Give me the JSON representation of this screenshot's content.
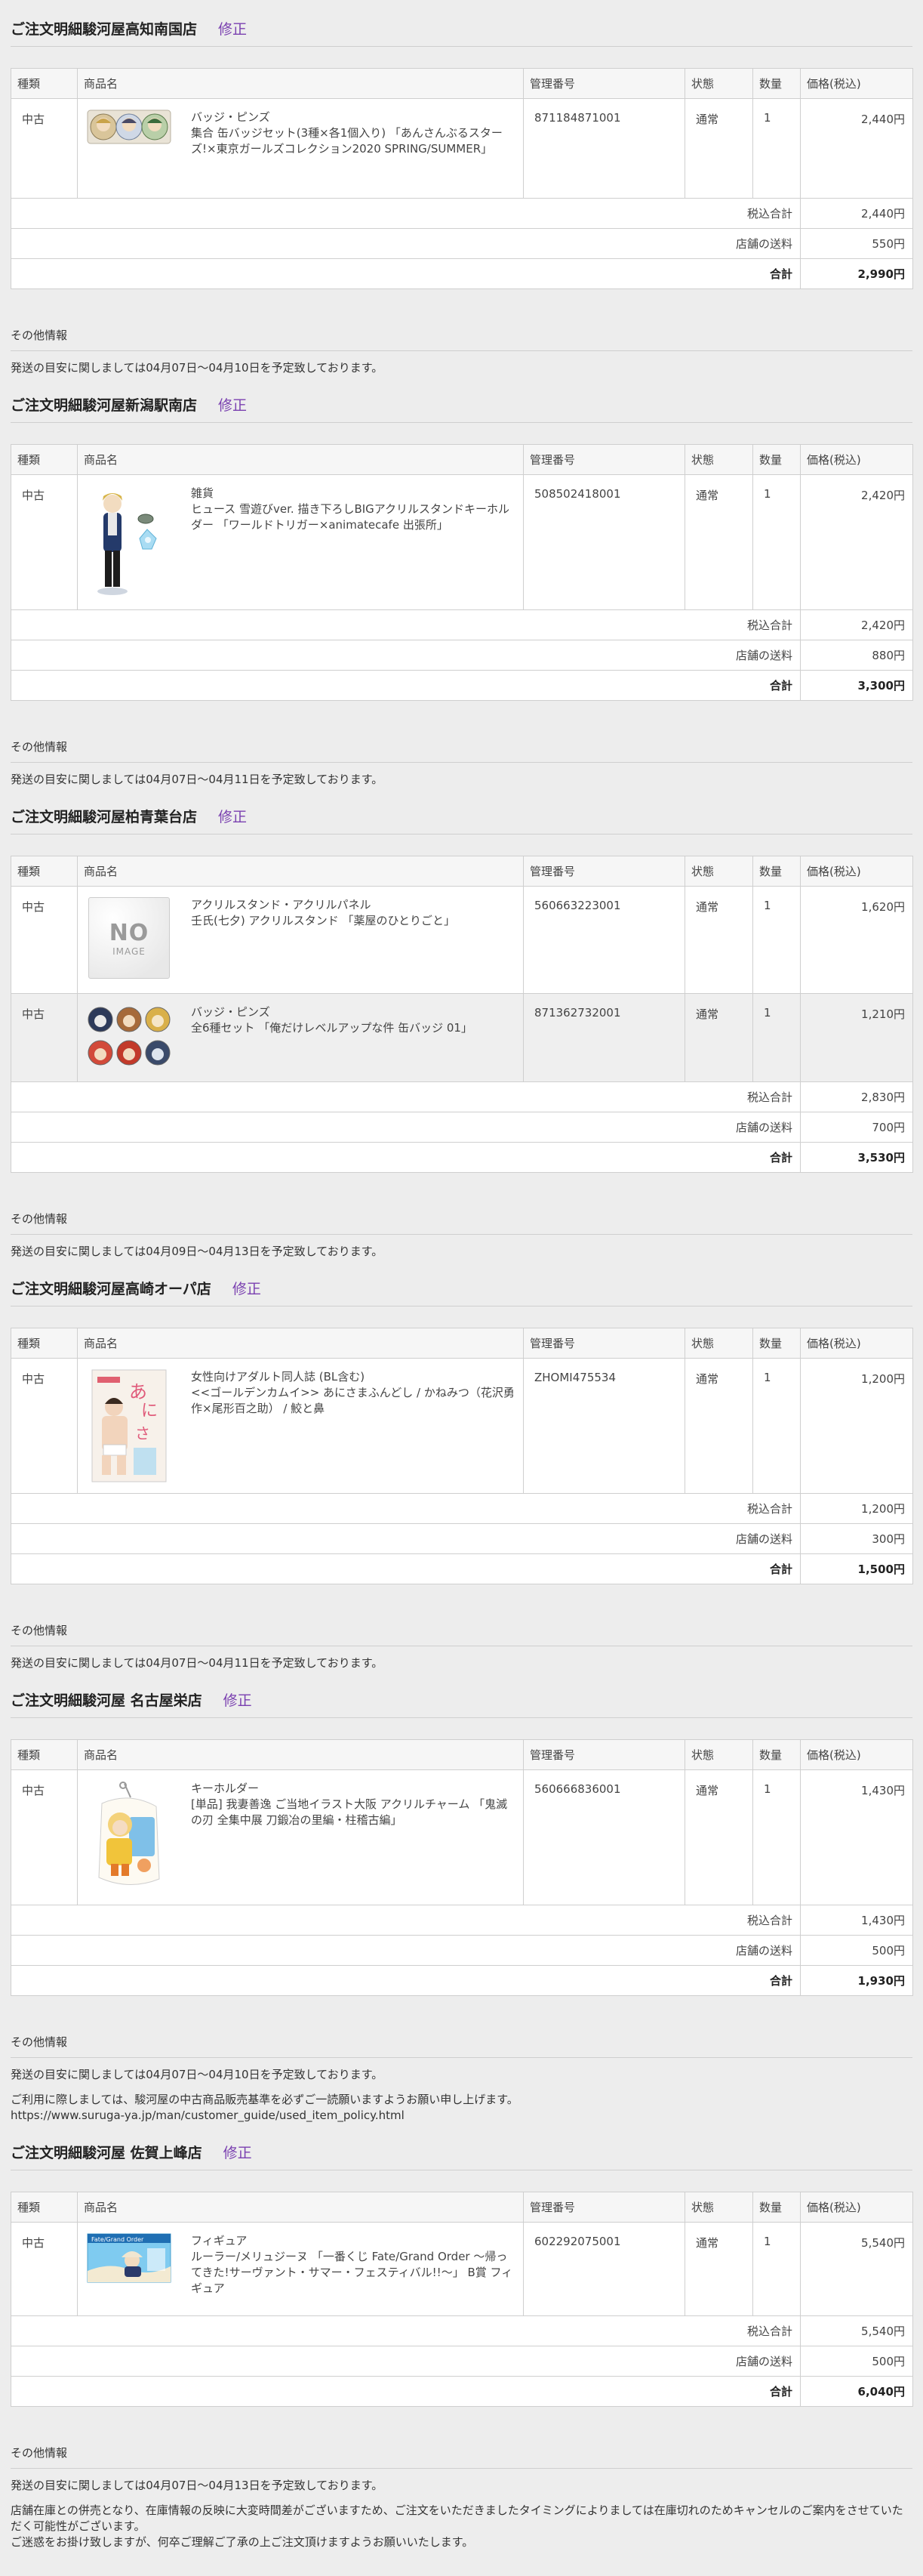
{
  "shops": [
    {
      "title": "ご注文明細駿河屋高知南国店",
      "edit": "修正",
      "headers": [
        "種類",
        "商品名",
        "管理番号",
        "状態",
        "数量",
        "価格(税込)"
      ],
      "items": [
        {
          "type": "中古",
          "category": "バッジ・ピンズ",
          "name": "集合 缶バッジセット(3種×各1個入り) 「あんさんぶるスターズ!×東京ガールズコレクション2020 SPRING/SUMMER」",
          "code": "871184871001",
          "status": "通常",
          "qty": "1",
          "price": "2,440円",
          "thumb": "badges3"
        }
      ],
      "summary": [
        {
          "label": "税込合計",
          "value": "2,440円"
        },
        {
          "label": "店舗の送料",
          "value": "550円"
        },
        {
          "label": "合計",
          "value": "2,990円"
        }
      ],
      "info_label": "その他情報",
      "info": [
        "発送の目安に関しましては04月07日～04月10日を予定致しております。"
      ]
    },
    {
      "title": "ご注文明細駿河屋新潟駅南店",
      "edit": "修正",
      "headers": [
        "種類",
        "商品名",
        "管理番号",
        "状態",
        "数量",
        "価格(税込)"
      ],
      "items": [
        {
          "type": "中古",
          "category": "雑貨",
          "name": "ヒュース 雪遊びver. 描き下ろしBIGアクリルスタンドキーホルダー 「ワールドトリガー×animatecafe 出張所」",
          "code": "508502418001",
          "status": "通常",
          "qty": "1",
          "price": "2,420円",
          "thumb": "figure"
        }
      ],
      "summary": [
        {
          "label": "税込合計",
          "value": "2,420円"
        },
        {
          "label": "店舗の送料",
          "value": "880円"
        },
        {
          "label": "合計",
          "value": "3,300円"
        }
      ],
      "info_label": "その他情報",
      "info": [
        "発送の目安に関しましては04月07日～04月11日を予定致しております。"
      ]
    },
    {
      "title": "ご注文明細駿河屋柏青葉台店",
      "edit": "修正",
      "headers": [
        "種類",
        "商品名",
        "管理番号",
        "状態",
        "数量",
        "価格(税込)"
      ],
      "items": [
        {
          "type": "中古",
          "category": "アクリルスタンド・アクリルパネル",
          "name": "壬氏(七夕) アクリルスタンド 「薬屋のひとりごと」",
          "code": "560663223001",
          "status": "通常",
          "qty": "1",
          "price": "1,620円",
          "thumb": "noimage",
          "noimg_big": "NO",
          "noimg_small": "IMAGE"
        },
        {
          "type": "中古",
          "category": "バッジ・ピンズ",
          "name": "全6種セット 「俺だけレベルアップな件 缶バッジ 01」",
          "code": "871362732001",
          "status": "通常",
          "qty": "1",
          "price": "1,210円",
          "thumb": "badges6"
        }
      ],
      "summary": [
        {
          "label": "税込合計",
          "value": "2,830円"
        },
        {
          "label": "店舗の送料",
          "value": "700円"
        },
        {
          "label": "合計",
          "value": "3,530円"
        }
      ],
      "info_label": "その他情報",
      "info": [
        "発送の目安に関しましては04月09日～04月13日を予定致しております。"
      ]
    },
    {
      "title": "ご注文明細駿河屋高崎オーパ店",
      "edit": "修正",
      "headers": [
        "種類",
        "商品名",
        "管理番号",
        "状態",
        "数量",
        "価格(税込)"
      ],
      "items": [
        {
          "type": "中古",
          "category": "女性向けアダルト同人誌 (BL含む)",
          "name": "<<ゴールデンカムイ>> あにさまふんどし / かねみつ（花沢勇作×尾形百之助） / 鮫と鼻",
          "code": "ZHOMI475534",
          "status": "通常",
          "qty": "1",
          "price": "1,200円",
          "thumb": "book"
        }
      ],
      "summary": [
        {
          "label": "税込合計",
          "value": "1,200円"
        },
        {
          "label": "店舗の送料",
          "value": "300円"
        },
        {
          "label": "合計",
          "value": "1,500円"
        }
      ],
      "info_label": "その他情報",
      "info": [
        "発送の目安に関しましては04月07日～04月11日を予定致しております。"
      ]
    },
    {
      "title": "ご注文明細駿河屋 名古屋栄店",
      "edit": "修正",
      "headers": [
        "種類",
        "商品名",
        "管理番号",
        "状態",
        "数量",
        "価格(税込)"
      ],
      "items": [
        {
          "type": "中古",
          "category": "キーホルダー",
          "name": "[単品] 我妻善逸 ご当地イラスト大阪 アクリルチャーム 「鬼滅の刃 全集中展 刀鍛冶の里編・柱稽古編」",
          "code": "560666836001",
          "status": "通常",
          "qty": "1",
          "price": "1,430円",
          "thumb": "charm"
        }
      ],
      "summary": [
        {
          "label": "税込合計",
          "value": "1,430円"
        },
        {
          "label": "店舗の送料",
          "value": "500円"
        },
        {
          "label": "合計",
          "value": "1,930円"
        }
      ],
      "info_label": "その他情報",
      "info": [
        "発送の目安に関しましては04月07日～04月10日を予定致しております。",
        "",
        "ご利用に際しましては、駿河屋の中古商品販売基準を必ずご一読願いますようお願い申し上げます。",
        "https://www.suruga-ya.jp/man/customer_guide/used_item_policy.html"
      ]
    },
    {
      "title": "ご注文明細駿河屋 佐賀上峰店",
      "edit": "修正",
      "headers": [
        "種類",
        "商品名",
        "管理番号",
        "状態",
        "数量",
        "価格(税込)"
      ],
      "items": [
        {
          "type": "中古",
          "category": "フィギュア",
          "name": "ルーラー/メリュジーヌ 「一番くじ Fate/Grand Order ～帰ってきた!サーヴァント・サマー・フェスティバル!!～」 B賞 フィギュア",
          "code": "602292075001",
          "status": "通常",
          "qty": "1",
          "price": "5,540円",
          "thumb": "box"
        }
      ],
      "summary": [
        {
          "label": "税込合計",
          "value": "5,540円"
        },
        {
          "label": "店舗の送料",
          "value": "500円"
        },
        {
          "label": "合計",
          "value": "6,040円"
        }
      ],
      "info_label": "その他情報",
      "info": [
        "発送の目安に関しましては04月07日～04月13日を予定致しております。",
        "",
        "店舗在庫との併売となり、在庫情報の反映に大変時間差がございますため、ご注文をいただきましたタイミングによりましては在庫切れのためキャンセルのご案内をさせていただく可能性がございます。",
        "ご迷惑をお掛け致しますが、何卒ご理解ご了承の上ご注文頂けますようお願いいたします。"
      ]
    }
  ],
  "colors": {
    "link": "#7a40b0",
    "background": "#ededed",
    "border": "#cfcfcf"
  }
}
